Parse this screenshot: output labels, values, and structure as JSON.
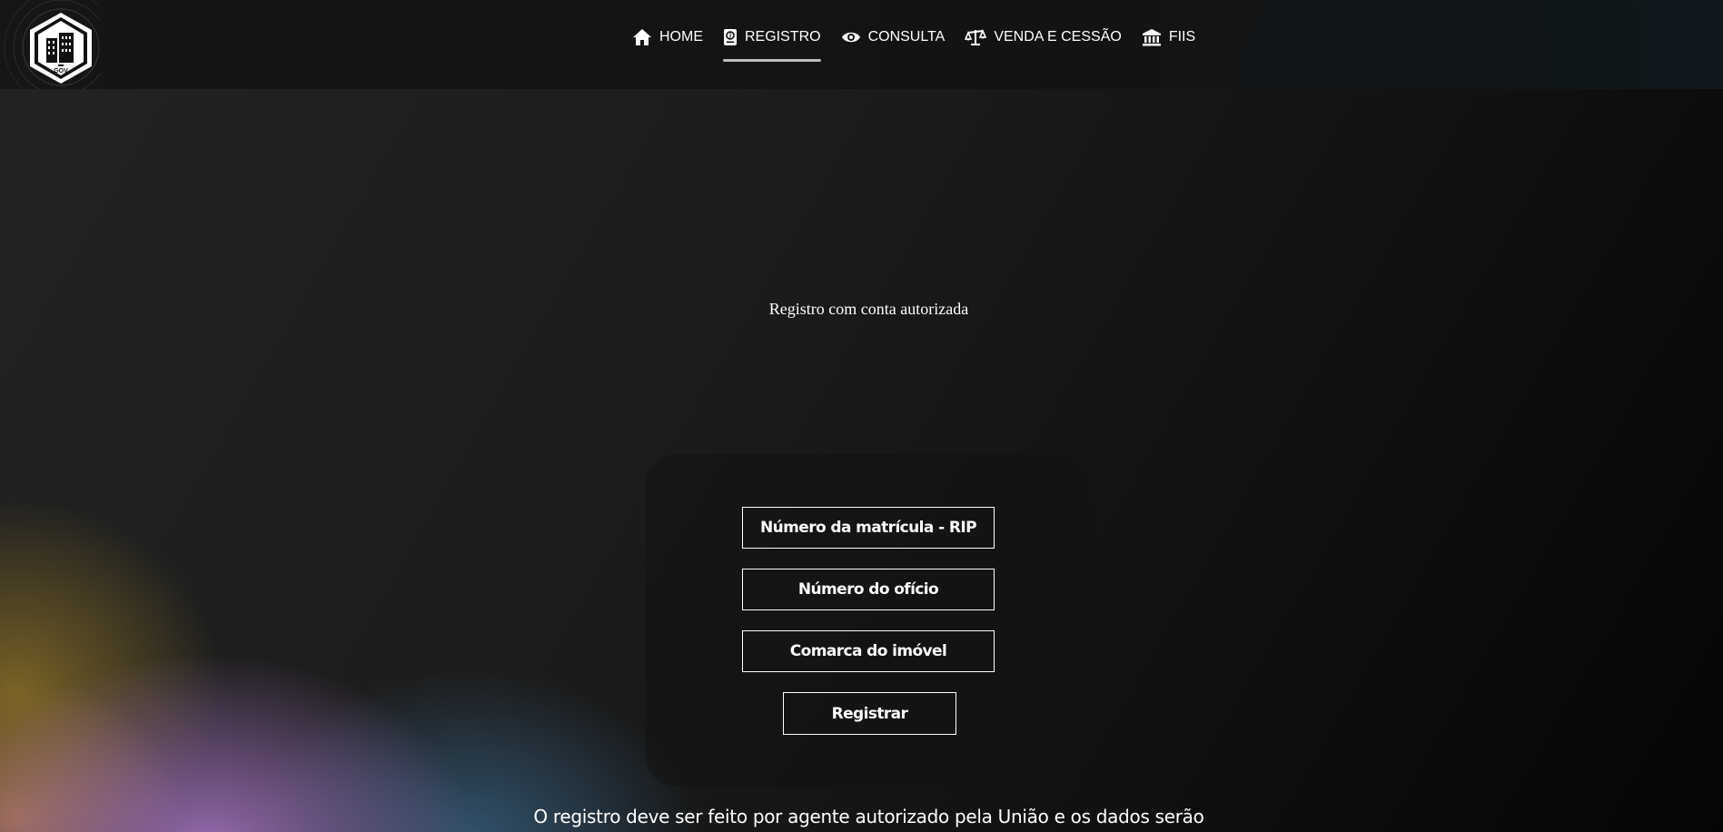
{
  "header": {
    "logo_text": "GOV",
    "nav": [
      {
        "label": "HOME",
        "icon": "home-icon"
      },
      {
        "label": "REGISTRO",
        "icon": "passport-icon",
        "active": true
      },
      {
        "label": "CONSULTA",
        "icon": "eye-icon"
      },
      {
        "label": "VENDA E CESSÃO",
        "icon": "scale-icon"
      },
      {
        "label": "FIIS",
        "icon": "bank-icon"
      }
    ]
  },
  "main": {
    "subtitle": "Registro com conta autorizada",
    "fields": {
      "rip_placeholder": "Número da matrícula - RIP",
      "oficio_placeholder": "Número do ofício",
      "comarca_placeholder": "Comarca do imóvel"
    },
    "submit_label": "Registrar",
    "footer_text": "O registro deve ser feito por agente autorizado pela União e os dados serão"
  },
  "colors": {
    "text": "#ffffff",
    "active_underline": "#bdbdbd",
    "background": "#1c1c1c"
  }
}
